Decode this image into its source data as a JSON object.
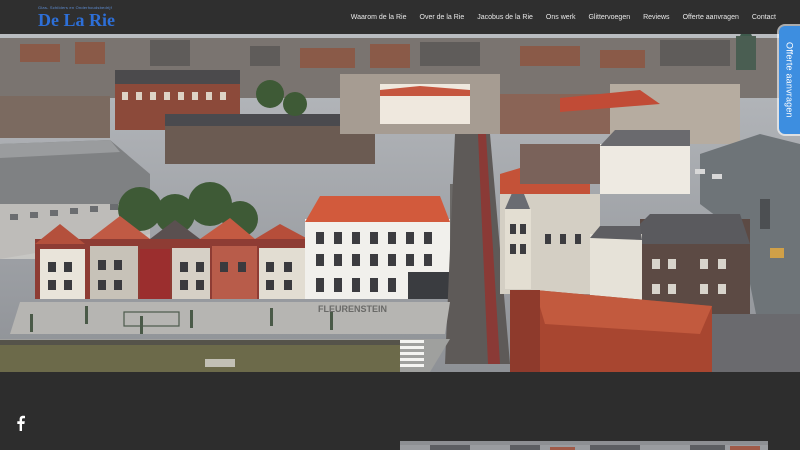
{
  "brand": {
    "tagline": "Glas- Schilders en Onderhoudsbedrijf",
    "name": "De La Rie"
  },
  "nav": {
    "items": [
      {
        "label": "Waarom de la Rie"
      },
      {
        "label": "Over de la Rie"
      },
      {
        "label": "Jacobus de la Rie"
      },
      {
        "label": "Ons werk"
      },
      {
        "label": "Glittervoegen"
      },
      {
        "label": "Reviews"
      },
      {
        "label": "Offerte aanvragen"
      },
      {
        "label": "Contact"
      }
    ]
  },
  "side_tab": {
    "label": "Offerte aanvragen"
  },
  "social": {
    "icon": "facebook-icon"
  },
  "hero": {
    "shop_sign": "FLEURENSTEIN"
  },
  "colors": {
    "header_bg": "#2f2f2f",
    "brand_blue": "#2d6fd8",
    "side_tab_bg": "#3d8ee0",
    "footer_bg": "#2d2d2d"
  }
}
